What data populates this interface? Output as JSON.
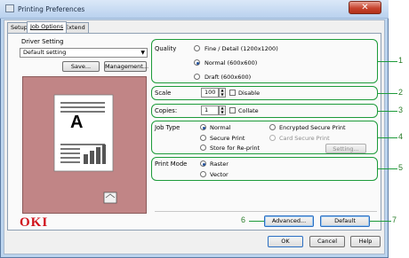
{
  "window": {
    "title": "Printing Preferences",
    "close_symbol": "✕"
  },
  "tabs": [
    {
      "label": "Setup",
      "active": false
    },
    {
      "label": "Job Options",
      "active": true
    },
    {
      "label": "Extend",
      "active": false
    }
  ],
  "driver_setting": {
    "label": "Driver Setting",
    "selected": "Default setting",
    "save_label": "Save...",
    "management_label": "Management..."
  },
  "quality": {
    "label": "Quality",
    "options": [
      {
        "label": "Fine / Detail (1200x1200)",
        "selected": false
      },
      {
        "label": "Normal (600x600)",
        "selected": true
      },
      {
        "label": "Draft (600x600)",
        "selected": false
      }
    ]
  },
  "scale": {
    "label": "Scale",
    "value": "100",
    "disable_label": "Disable",
    "disable_checked": false
  },
  "copies": {
    "label": "Copies:",
    "value": "1",
    "collate_label": "Collate",
    "collate_checked": false
  },
  "job_type": {
    "label": "Job Type",
    "options": [
      {
        "label": "Normal",
        "selected": true,
        "enabled": true
      },
      {
        "label": "Encrypted Secure Print",
        "selected": false,
        "enabled": true
      },
      {
        "label": "Secure Print",
        "selected": false,
        "enabled": true
      },
      {
        "label": "Card Secure Print",
        "selected": false,
        "enabled": false
      },
      {
        "label": "Store for Re-print",
        "selected": false,
        "enabled": true
      }
    ],
    "setting_label": "Setting..."
  },
  "print_mode": {
    "label": "Print Mode",
    "options": [
      {
        "label": "Raster",
        "selected": true
      },
      {
        "label": "Vector",
        "selected": false
      }
    ]
  },
  "preview": {
    "letter": "A"
  },
  "brand": {
    "logo_text": "OKI",
    "color": "#d0121b"
  },
  "footer": {
    "advanced_label": "Advanced...",
    "default_label": "Default",
    "ok_label": "OK",
    "cancel_label": "Cancel",
    "help_label": "Help"
  },
  "callouts": [
    "1",
    "2",
    "3",
    "4",
    "5",
    "6",
    "7"
  ],
  "colors": {
    "callout_green": "#1d9b3a",
    "preview_bg": "#c18586"
  }
}
